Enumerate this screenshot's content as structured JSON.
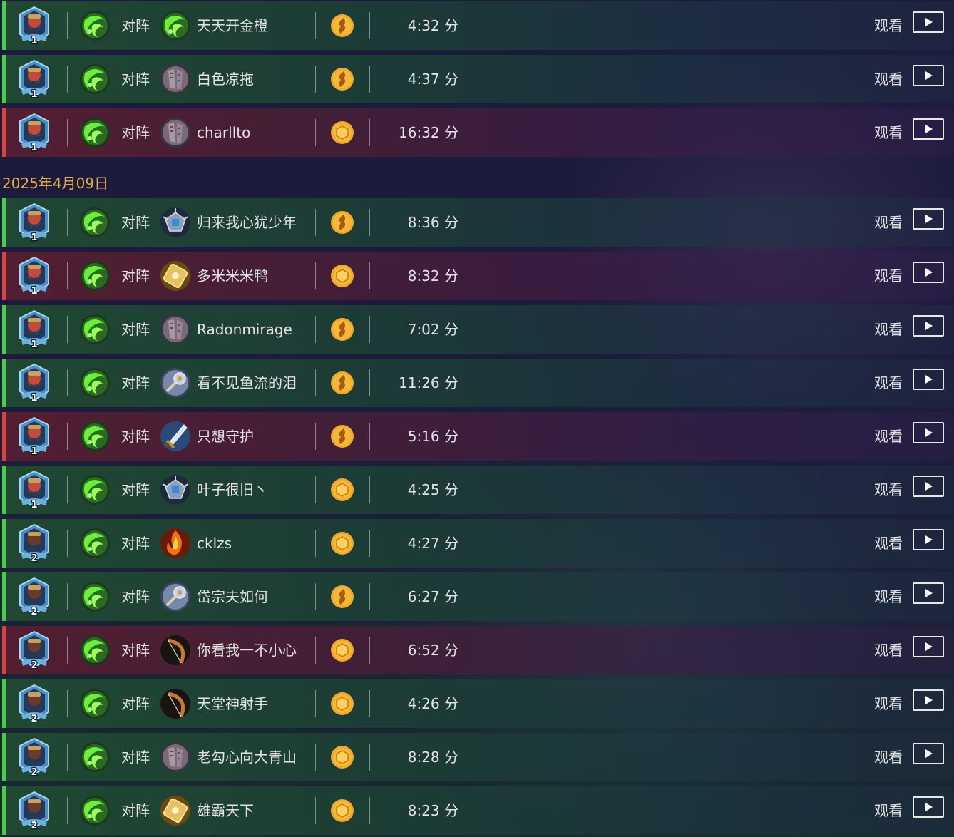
{
  "date_header": "2025年4月09日",
  "vs_label": "对阵",
  "watch_label": "观看",
  "colors": {
    "win": "#3fd33f",
    "loss": "#e0403a",
    "date": "#e8b04a",
    "coin": "#f0a92a"
  },
  "games": [
    {
      "result": "win",
      "rank": "1",
      "opponent": "天天开金橙",
      "opp_class_icon": "druid-swirl-icon",
      "coin": "first-icon",
      "duration": "4:32 分"
    },
    {
      "result": "win",
      "rank": "1",
      "opponent": "白色凉拖",
      "opp_class_icon": "shaman-stone-icon",
      "coin": "first-icon",
      "duration": "4:37 分"
    },
    {
      "result": "loss",
      "rank": "1",
      "opponent": "charllto",
      "opp_class_icon": "shaman-stone-icon",
      "coin": "second-icon",
      "duration": "16:32 分"
    },
    {
      "result": "win",
      "rank": "1",
      "opponent": "归来我心犹少年",
      "opp_class_icon": "mage-crystal-icon",
      "coin": "first-icon",
      "duration": "8:36 分"
    },
    {
      "result": "loss",
      "rank": "1",
      "opponent": "多米米米鸭",
      "opp_class_icon": "paladin-gold-icon",
      "coin": "second-icon",
      "duration": "8:32 分"
    },
    {
      "result": "win",
      "rank": "1",
      "opponent": "Radonmirage",
      "opp_class_icon": "shaman-stone-icon",
      "coin": "first-icon",
      "duration": "7:02 分"
    },
    {
      "result": "win",
      "rank": "1",
      "opponent": "看不见鱼流的泪",
      "opp_class_icon": "priest-mace-icon",
      "coin": "first-icon",
      "duration": "11:26 分"
    },
    {
      "result": "loss",
      "rank": "1",
      "opponent": "只想守护",
      "opp_class_icon": "warrior-sword-icon",
      "coin": "first-icon",
      "duration": "5:16 分"
    },
    {
      "result": "win",
      "rank": "1",
      "opponent": "叶子很旧丶",
      "opp_class_icon": "mage-crystal-icon",
      "coin": "second-icon",
      "duration": "4:25 分"
    },
    {
      "result": "win",
      "rank": "2",
      "opponent": "cklzs",
      "opp_class_icon": "warlock-fire-icon",
      "coin": "second-icon",
      "duration": "4:27 分"
    },
    {
      "result": "win",
      "rank": "2",
      "opponent": "岱宗夫如何",
      "opp_class_icon": "priest-mace-icon",
      "coin": "first-icon",
      "duration": "6:27 分"
    },
    {
      "result": "loss",
      "rank": "2",
      "opponent": "你看我一不小心",
      "opp_class_icon": "hunter-bow-icon",
      "coin": "second-icon",
      "duration": "6:52 分"
    },
    {
      "result": "win",
      "rank": "2",
      "opponent": "天堂神射手",
      "opp_class_icon": "hunter-bow-icon",
      "coin": "second-icon",
      "duration": "4:26 分"
    },
    {
      "result": "win",
      "rank": "2",
      "opponent": "老勾心向大青山",
      "opp_class_icon": "shaman-stone-icon",
      "coin": "second-icon",
      "duration": "8:28 分"
    },
    {
      "result": "win",
      "rank": "2",
      "opponent": "雄霸天下",
      "opp_class_icon": "paladin-gold-icon",
      "coin": "second-icon",
      "duration": "8:23 分"
    }
  ]
}
